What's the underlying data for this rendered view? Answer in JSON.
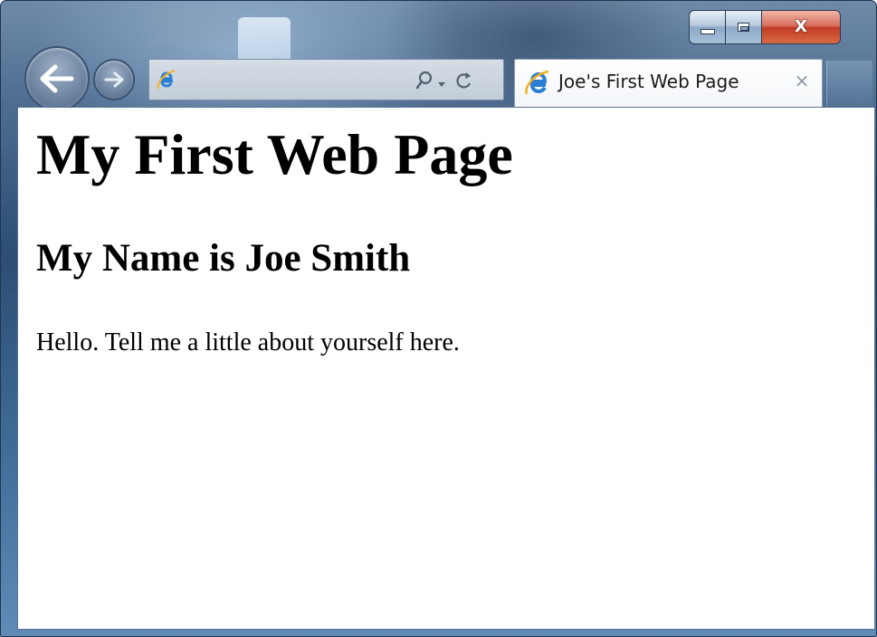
{
  "window": {
    "caption_buttons": {
      "minimize_icon": "minimize-icon",
      "maximize_icon": "maximize-icon",
      "close_label": "X"
    }
  },
  "toolbar": {
    "back_icon": "back-arrow-icon",
    "forward_icon": "forward-arrow-icon",
    "address": {
      "value": "",
      "icon": "ie-logo-icon",
      "search_icon": "search-icon",
      "dropdown_icon": "dropdown-arrow-icon",
      "refresh_icon": "refresh-icon"
    }
  },
  "tab": {
    "title": "Joe's First Web Page",
    "close_label": "×",
    "icon": "ie-logo-icon"
  },
  "page": {
    "heading1": "My First Web Page",
    "heading2": "My Name is Joe Smith",
    "paragraph": "Hello. Tell me a little about yourself here."
  },
  "colors": {
    "window_frame": "#2c4d74",
    "close_button": "#c33c25",
    "content_background": "#ffffff",
    "text": "#000000"
  }
}
